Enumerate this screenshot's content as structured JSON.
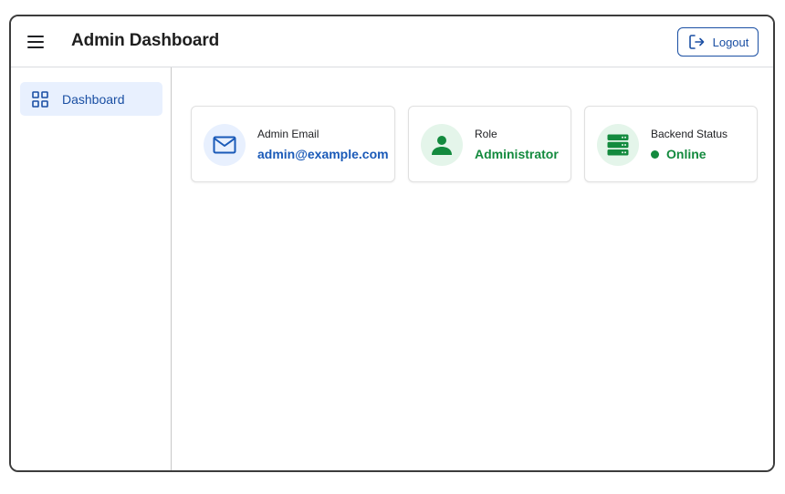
{
  "header": {
    "title": "Admin Dashboard",
    "menu_icon": "hamburger-menu-icon",
    "logout_label": "Logout",
    "logout_icon": "logout-icon"
  },
  "sidebar": {
    "items": [
      {
        "label": "Dashboard",
        "icon": "grid-icon",
        "active": true
      }
    ]
  },
  "cards": {
    "email": {
      "label": "Admin Email",
      "value": "admin@example.com",
      "icon": "mail-icon"
    },
    "role": {
      "label": "Role",
      "value": "Administrator",
      "icon": "person-icon"
    },
    "status": {
      "label": "Backend Status",
      "value": "Online",
      "icon": "server-icon"
    }
  },
  "colors": {
    "accent_blue": "#1a4fa3",
    "active_bg": "#e8f0fe",
    "success_green": "#138a3e",
    "success_bg": "#e4f5ea"
  }
}
